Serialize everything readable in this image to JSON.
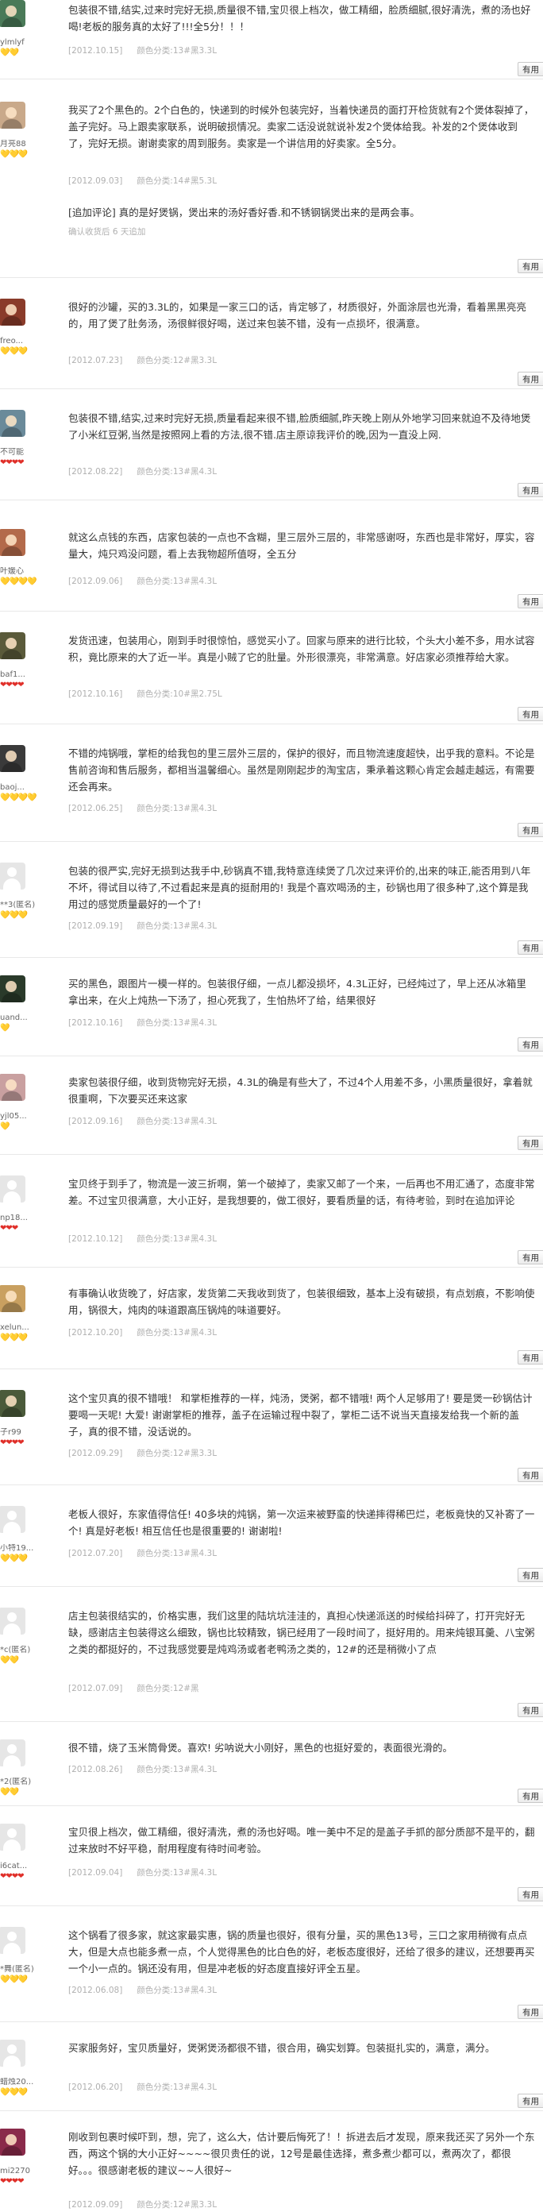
{
  "useful_label": "有用",
  "reviews": [
    {
      "nick": "ylmlyf",
      "rank_icons": "💛💛",
      "rank_color": "#f0b400",
      "avatar_color": "#4a7a58",
      "content": "包装很不错,结实,过来时完好无损,质量很不错,宝贝很上档次，做工精细，脸质细腻,很好清洗，煮的汤也好喝!老板的服务真的太好了!!!全5分！！！",
      "date": "[2012.10.15]",
      "attr": "颜色分类:13#黑3.3L"
    },
    {
      "nick": "月亮88",
      "rank_icons": "💛💛💛",
      "rank_color": "#f0b400",
      "avatar_color": "#c9a98a",
      "content": "我买了2个黑色的。2个白色的，快递到的时候外包装完好，当着快递员的面打开检货就有2个煲体裂掉了，盖子完好。马上跟卖家联系，说明破损情况。卖家二话没说就说补发2个煲体给我。补发的2个煲体收到了，完好无损。谢谢卖家的周到服务。卖家是一个讲信用的好卖家。全5分。",
      "date": "[2012.09.03]",
      "attr": "颜色分类:14#黑5.3L",
      "followup_tag": "[追加评论]",
      "followup": " 真的是好煲锅，煲出来的汤好香好香.和不锈钢锅煲出来的是两会事。",
      "followup_note": "确认收货后 6 天追加"
    },
    {
      "nick": "freo...",
      "rank_icons": "💛💛💛",
      "rank_color": "#f0b400",
      "avatar_color": "#8a3b2a",
      "content": "很好的沙罐，买的3.3L的，如果是一家三口的话，肯定够了，材质很好，外面涂层也光滑，看着黑黑亮亮的，用了煲了肚务汤，汤很鲜很好喝，送过来包装不错，没有一点损坏，很满意。",
      "date": "[2012.07.23]",
      "attr": "颜色分类:12#黑3.3L"
    },
    {
      "nick": "不可能",
      "rank_icons": "❤❤❤❤",
      "rank_color": "#e0302a",
      "avatar_color": "#6a8a9a",
      "content": "包装很不错,结实,过来时完好无损,质量看起来很不错,脸质细腻,昨天晚上刚从外地学习回来就迫不及待地煲了小米红豆粥,当然是按照网上看的方法,很不错.店主原谅我评价的晚,因为一直没上网.",
      "date": "[2012.08.22]",
      "attr": "颜色分类:13#黑4.3L"
    },
    {
      "nick": "叶媛心",
      "rank_icons": "💛💛💛💛",
      "rank_color": "#f0b400",
      "avatar_color": "#b36a4a",
      "content": "就这么点钱的东西，店家包装的一点也不含糊，里三层外三层的，非常感谢呀，东西也是非常好，厚实，容量大，炖只鸡没问题，看上去我物超所值呀，全五分",
      "date": "[2012.09.06]",
      "attr": "颜色分类:13#黑4.3L"
    },
    {
      "nick": "baf1...",
      "rank_icons": "❤❤❤❤",
      "rank_color": "#e0302a",
      "avatar_color": "#5a5a3a",
      "content": "发货迅速，包装用心，刚到手时很惊怕，感觉买小了。回家与原来的进行比较，个头大小差不多，用水试容积，竟比原来的大了近一半。真是小贼了它的肚量。外形很漂亮，非常满意。好店家必须推荐给大家。",
      "date": "[2012.10.16]",
      "attr": "颜色分类:10#黑2.75L"
    },
    {
      "nick": "baoj...",
      "rank_icons": "💛💛💛💛",
      "rank_color": "#f0b400",
      "avatar_color": "#3a3a3a",
      "content": "不错的炖锅哦，掌柜的给我包的里三层外三层的，保护的很好，而且物流速度超快，出乎我的意料。不论是售前咨询和售后服务，都相当温馨细心。虽然是刚刚起步的淘宝店，秉承着这颗心肯定会越走越远，有需要还会再来。",
      "date": "[2012.06.25]",
      "attr": "颜色分类:13#黑4.3L"
    },
    {
      "nick": "**3(匿名)",
      "rank_icons": "💛💛💛",
      "rank_color": "#f0b400",
      "avatar_color": "default",
      "content": "包装的很严实,完好无损到达我手中,砂锅真不错,我特意连续煲了几次过来评价的,出来的味正,能否用到八年不坏，得试目以待了,不过看起来是真的挺耐用的! 我是个喜欢喝汤的主，砂锅也用了很多种了,这个算是我用过的感觉质量最好的一个了!",
      "date": "[2012.09.19]",
      "attr": "颜色分类:13#黑4.3L"
    },
    {
      "nick": "uand...",
      "rank_icons": "💛",
      "rank_color": "#f0b400",
      "avatar_color": "#2a3a2a",
      "content": "买的黑色，跟图片一模一样的。包装很仔细，一点儿都没损坏，4.3L正好，已经炖过了，早上还从冰箱里拿出来，在火上炖热一下汤了，担心死我了，生怕热坏了给，结果很好",
      "date": "[2012.10.16]",
      "attr": "颜色分类:13#黑4.3L"
    },
    {
      "nick": "yjl05...",
      "rank_icons": "💛",
      "rank_color": "#f0b400",
      "avatar_color": "#c9a0a0",
      "content": "卖家包装很仔细，收到货物完好无损，4.3L的确是有些大了，不过4个人用差不多，小黑质量很好，拿着就很重啊，下次要买还来这家",
      "date": "[2012.09.16]",
      "attr": "颜色分类:13#黑4.3L"
    },
    {
      "nick": "np18...",
      "rank_icons": "❤❤❤",
      "rank_color": "#e0302a",
      "avatar_color": "default",
      "content": "宝贝终于到手了，物流是一波三折啊，第一个破掉了，卖家又邮了一个来，一后再也不用汇通了，态度非常差。不过宝贝很满意，大小正好，是我想要的，做工很好，要看质量的话，有待考验，到时在追加评论",
      "date": "[2012.10.12]",
      "attr": "颜色分类:13#黑4.3L"
    },
    {
      "nick": "xelun...",
      "rank_icons": "💛💛💛",
      "rank_color": "#f0b400",
      "avatar_color": "#c9a060",
      "content": "有事确认收货晚了，好店家，发货第二天我收到货了，包装很细致，基本上没有破损，有点划痕，不影响使用，锅很大，炖肉的味道跟高压锅炖的味道要好。",
      "date": "[2012.10.20]",
      "attr": "颜色分类:13#黑4.3L"
    },
    {
      "nick": "子r99",
      "rank_icons": "❤❤❤❤",
      "rank_color": "#e0302a",
      "avatar_color": "#4a5a3a",
      "content": "这个宝贝真的很不错哦！ 和掌柜推荐的一样，炖汤，煲粥，都不错哦! 两个人足够用了! 要是煲一砂锅估计要喝一天呢! 大爱! 谢谢掌柜的推荐，盖子在运输过程中裂了，掌柜二话不说当天直接发给我一个新的盖子，真的很不错，没话说的。",
      "date": "[2012.09.29]",
      "attr": "颜色分类:12#黑3.3L"
    },
    {
      "nick": "小特19...",
      "rank_icons": "💛💛💛",
      "rank_color": "#f0b400",
      "avatar_color": "default",
      "content": "老板人很好，东家值得信任! 40多块的炖锅，第一次运来被野蛮的快递摔得稀巴烂，老板竟快的又补寄了一个! 真是好老板! 相互信任也是很重要的! 谢谢啦!",
      "date": "[2012.07.20]",
      "attr": "颜色分类:13#黑4.3L"
    },
    {
      "nick": "*c(匿名)",
      "rank_icons": "💛💛",
      "rank_color": "#f0b400",
      "avatar_color": "default",
      "content": "店主包装很结实的，价格实惠，我们这里的陆坑坑洼洼的，真担心快递派送的时候给抖碎了，打开完好无缺，感谢店主包装得这么细致，锅也比较精致，锅已经用了一段时间了，挺好用的。用来炖银耳羹、八宝粥之类的都挺好的，不过我感觉要是炖鸡汤或者老鸭汤之类的，12#的还是稍微小了点",
      "date": "[2012.07.09]",
      "attr": "颜色分类:12#黑"
    },
    {
      "nick": "*2(匿名)",
      "rank_icons": "💛💛",
      "rank_color": "#f0b400",
      "avatar_color": "default",
      "content": "很不错，烧了玉米筒骨煲。喜欢! 劣呐说大小刚好，黑色的也挺好爱的，表面很光滑的。",
      "date": "[2012.08.26]",
      "attr": "颜色分类:13#黑4.3L"
    },
    {
      "nick": "i6cat...",
      "rank_icons": "❤❤❤❤",
      "rank_color": "#e0302a",
      "avatar_color": "default",
      "content": "宝贝很上档次，做工精细，很好清洗，煮的汤也好喝。唯一美中不足的是盖子手抓的部分质部不是平的，翻过来放时不好平稳，耐用程度有待时间考验。",
      "date": "[2012.09.04]",
      "attr": "颜色分类:13#黑4.3L"
    },
    {
      "nick": "*舞(匿名)",
      "rank_icons": "💛💛💛",
      "rank_color": "#f0b400",
      "avatar_color": "default",
      "content": "这个锅看了很多家，就这家最实惠，锅的质量也很好，很有分量，买的黑色13号，三口之家用稍微有点点大，但是大点也能多煮一点，个人觉得黑色的比白色的好，老板态度很好，还给了很多的建议，还想要再买一个小一点的。锅还没有用，但是冲老板的好态度直接好评全五星。",
      "date": "[2012.06.08]",
      "attr": "颜色分类:13#黑4.3L"
    },
    {
      "nick": "蜡烛20...",
      "rank_icons": "💛💛💛",
      "rank_color": "#f0b400",
      "avatar_color": "default",
      "content": "买家服务好，宝贝质量好，煲粥煲汤都很不错，很合用，确实划算。包装挺扎实的，满意，满分。",
      "date": "[2012.06.20]",
      "attr": "颜色分类:13#黑4.3L"
    },
    {
      "nick": "mi2270",
      "rank_icons": "❤❤❤❤",
      "rank_color": "#e0302a",
      "avatar_color": "#8a2a4a",
      "content": "刚收到包裹时候吓到，想，完了，这么大，估计要后悔死了！！拆进去后才发现，原来我还买了另外一个东西，两这个锅的大小正好~~~~很贝贵任的说，12号是最佳选择，煮多煮少都可以，煮两次了，都很好。。。很感谢老板的建议~~人很好~",
      "date": "[2012.09.09]",
      "attr": "颜色分类:12#黑3.3L"
    }
  ]
}
